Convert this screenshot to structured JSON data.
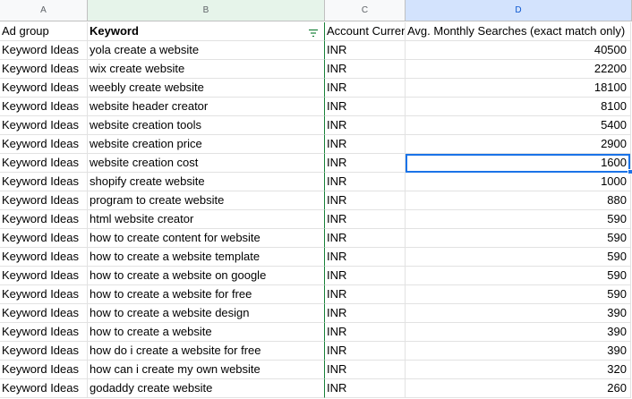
{
  "columns": [
    "A",
    "B",
    "C",
    "D"
  ],
  "header": {
    "ad_group": "Ad group",
    "keyword": "Keyword",
    "account_currency": "Account Currency",
    "avg_monthly_searches": "Avg. Monthly Searches (exact match only)"
  },
  "rows": [
    {
      "ad_group": "Keyword Ideas",
      "keyword": "yola create a website",
      "currency": "INR",
      "searches": "40500"
    },
    {
      "ad_group": "Keyword Ideas",
      "keyword": "wix create website",
      "currency": "INR",
      "searches": "22200"
    },
    {
      "ad_group": "Keyword Ideas",
      "keyword": "weebly create website",
      "currency": "INR",
      "searches": "18100"
    },
    {
      "ad_group": "Keyword Ideas",
      "keyword": "website header creator",
      "currency": "INR",
      "searches": "8100"
    },
    {
      "ad_group": "Keyword Ideas",
      "keyword": "website creation tools",
      "currency": "INR",
      "searches": "5400"
    },
    {
      "ad_group": "Keyword Ideas",
      "keyword": "website creation price",
      "currency": "INR",
      "searches": "2900"
    },
    {
      "ad_group": "Keyword Ideas",
      "keyword": "website creation cost",
      "currency": "INR",
      "searches": "1600"
    },
    {
      "ad_group": "Keyword Ideas",
      "keyword": "shopify create website",
      "currency": "INR",
      "searches": "1000"
    },
    {
      "ad_group": "Keyword Ideas",
      "keyword": "program to create website",
      "currency": "INR",
      "searches": "880"
    },
    {
      "ad_group": "Keyword Ideas",
      "keyword": "html website creator",
      "currency": "INR",
      "searches": "590"
    },
    {
      "ad_group": "Keyword Ideas",
      "keyword": "how to create content for website",
      "currency": "INR",
      "searches": "590"
    },
    {
      "ad_group": "Keyword Ideas",
      "keyword": "how to create a website template",
      "currency": "INR",
      "searches": "590"
    },
    {
      "ad_group": "Keyword Ideas",
      "keyword": "how to create a website on google",
      "currency": "INR",
      "searches": "590"
    },
    {
      "ad_group": "Keyword Ideas",
      "keyword": "how to create a website for free",
      "currency": "INR",
      "searches": "590"
    },
    {
      "ad_group": "Keyword Ideas",
      "keyword": "how to create a website design",
      "currency": "INR",
      "searches": "390"
    },
    {
      "ad_group": "Keyword Ideas",
      "keyword": "how to create a website",
      "currency": "INR",
      "searches": "390"
    },
    {
      "ad_group": "Keyword Ideas",
      "keyword": "how do i create a website for free",
      "currency": "INR",
      "searches": "390"
    },
    {
      "ad_group": "Keyword Ideas",
      "keyword": "how can i create my own website",
      "currency": "INR",
      "searches": "320"
    },
    {
      "ad_group": "Keyword Ideas",
      "keyword": "godaddy create website",
      "currency": "INR",
      "searches": "260"
    }
  ],
  "active_cell_value": "1600",
  "colors": {
    "selection": "#1a73e8",
    "filter_column": "#188038"
  },
  "icons": {
    "filter": "filter-icon"
  }
}
